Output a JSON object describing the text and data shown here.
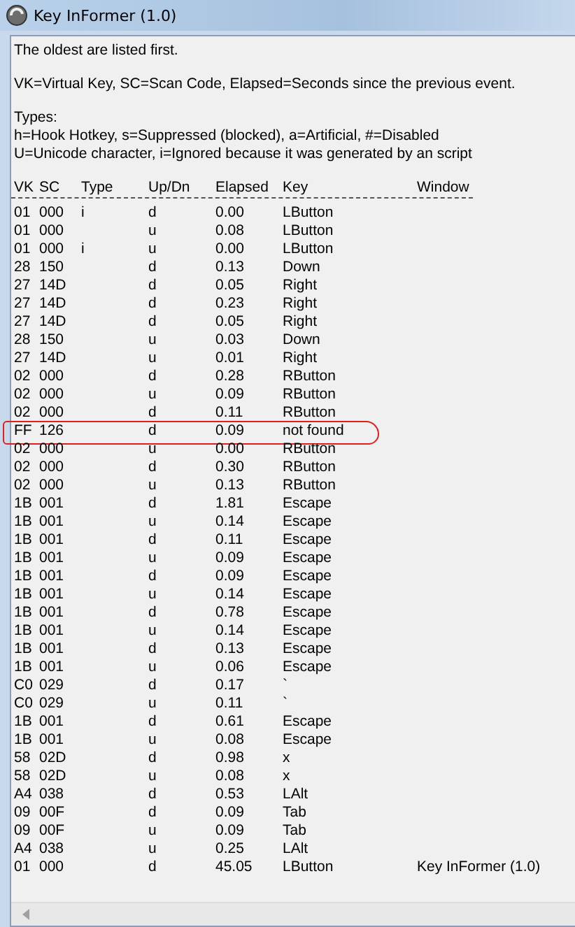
{
  "window": {
    "title": "Key InFormer (1.0)"
  },
  "intro": [
    "The oldest are listed first.",
    "VK=Virtual Key, SC=Scan Code, Elapsed=Seconds since the previous event.",
    "Types:",
    "h=Hook Hotkey, s=Suppressed (blocked), a=Artificial, #=Disabled",
    "U=Unicode character, i=Ignored because it was generated by an script"
  ],
  "table": {
    "columns": [
      "VK",
      "SC",
      "Type",
      "Up/Dn",
      "Elapsed",
      "Key",
      "Window"
    ],
    "rows": [
      {
        "cells": [
          "01",
          "000",
          "i",
          "d",
          "0.00",
          "LButton",
          ""
        ],
        "circled": false
      },
      {
        "cells": [
          "01",
          "000",
          "",
          "u",
          "0.08",
          "LButton",
          ""
        ],
        "circled": false
      },
      {
        "cells": [
          "01",
          "000",
          "i",
          "u",
          "0.00",
          "LButton",
          ""
        ],
        "circled": false
      },
      {
        "cells": [
          "28",
          "150",
          "",
          "d",
          "0.13",
          "Down",
          ""
        ],
        "circled": false
      },
      {
        "cells": [
          "27",
          "14D",
          "",
          "d",
          "0.05",
          "Right",
          ""
        ],
        "circled": false
      },
      {
        "cells": [
          "27",
          "14D",
          "",
          "d",
          "0.23",
          "Right",
          ""
        ],
        "circled": false
      },
      {
        "cells": [
          "27",
          "14D",
          "",
          "d",
          "0.05",
          "Right",
          ""
        ],
        "circled": false
      },
      {
        "cells": [
          "28",
          "150",
          "",
          "u",
          "0.03",
          "Down",
          ""
        ],
        "circled": false
      },
      {
        "cells": [
          "27",
          "14D",
          "",
          "u",
          "0.01",
          "Right",
          ""
        ],
        "circled": false
      },
      {
        "cells": [
          "02",
          "000",
          "",
          "d",
          "0.28",
          "RButton",
          ""
        ],
        "circled": false
      },
      {
        "cells": [
          "02",
          "000",
          "",
          "u",
          "0.09",
          "RButton",
          ""
        ],
        "circled": false
      },
      {
        "cells": [
          "02",
          "000",
          "",
          "d",
          "0.11",
          "RButton",
          ""
        ],
        "circled": false
      },
      {
        "cells": [
          "FF",
          "126",
          "",
          "d",
          "0.09",
          "not found",
          ""
        ],
        "circled": true
      },
      {
        "cells": [
          "02",
          "000",
          "",
          "u",
          "0.00",
          "RButton",
          ""
        ],
        "circled": false
      },
      {
        "cells": [
          "02",
          "000",
          "",
          "d",
          "0.30",
          "RButton",
          ""
        ],
        "circled": false
      },
      {
        "cells": [
          "02",
          "000",
          "",
          "u",
          "0.13",
          "RButton",
          ""
        ],
        "circled": false
      },
      {
        "cells": [
          "1B",
          "001",
          "",
          "d",
          "1.81",
          "Escape",
          ""
        ],
        "circled": false
      },
      {
        "cells": [
          "1B",
          "001",
          "",
          "u",
          "0.14",
          "Escape",
          ""
        ],
        "circled": false
      },
      {
        "cells": [
          "1B",
          "001",
          "",
          "d",
          "0.11",
          "Escape",
          ""
        ],
        "circled": false
      },
      {
        "cells": [
          "1B",
          "001",
          "",
          "u",
          "0.09",
          "Escape",
          ""
        ],
        "circled": false
      },
      {
        "cells": [
          "1B",
          "001",
          "",
          "d",
          "0.09",
          "Escape",
          ""
        ],
        "circled": false
      },
      {
        "cells": [
          "1B",
          "001",
          "",
          "u",
          "0.14",
          "Escape",
          ""
        ],
        "circled": false
      },
      {
        "cells": [
          "1B",
          "001",
          "",
          "d",
          "0.78",
          "Escape",
          ""
        ],
        "circled": false
      },
      {
        "cells": [
          "1B",
          "001",
          "",
          "u",
          "0.14",
          "Escape",
          ""
        ],
        "circled": false
      },
      {
        "cells": [
          "1B",
          "001",
          "",
          "d",
          "0.13",
          "Escape",
          ""
        ],
        "circled": false
      },
      {
        "cells": [
          "1B",
          "001",
          "",
          "u",
          "0.06",
          "Escape",
          ""
        ],
        "circled": false
      },
      {
        "cells": [
          "C0",
          "029",
          "",
          "d",
          "0.17",
          "`",
          ""
        ],
        "circled": false
      },
      {
        "cells": [
          "C0",
          "029",
          "",
          "u",
          "0.11",
          "`",
          ""
        ],
        "circled": false
      },
      {
        "cells": [
          "1B",
          "001",
          "",
          "d",
          "0.61",
          "Escape",
          ""
        ],
        "circled": false
      },
      {
        "cells": [
          "1B",
          "001",
          "",
          "u",
          "0.08",
          "Escape",
          ""
        ],
        "circled": false
      },
      {
        "cells": [
          "58",
          "02D",
          "",
          "d",
          "0.98",
          "x",
          ""
        ],
        "circled": false
      },
      {
        "cells": [
          "58",
          "02D",
          "",
          "u",
          "0.08",
          "x",
          ""
        ],
        "circled": false
      },
      {
        "cells": [
          "A4",
          "038",
          "",
          "d",
          "0.53",
          "LAlt",
          ""
        ],
        "circled": false
      },
      {
        "cells": [
          "09",
          "00F",
          "",
          "d",
          "0.09",
          "Tab",
          ""
        ],
        "circled": false
      },
      {
        "cells": [
          "09",
          "00F",
          "",
          "u",
          "0.09",
          "Tab",
          ""
        ],
        "circled": false
      },
      {
        "cells": [
          "A4",
          "038",
          "",
          "u",
          "0.25",
          "LAlt",
          ""
        ],
        "circled": false
      },
      {
        "cells": [
          "01",
          "000",
          "",
          "d",
          "45.05",
          "LButton",
          "Key InFormer (1.0)"
        ],
        "circled": false
      }
    ]
  }
}
